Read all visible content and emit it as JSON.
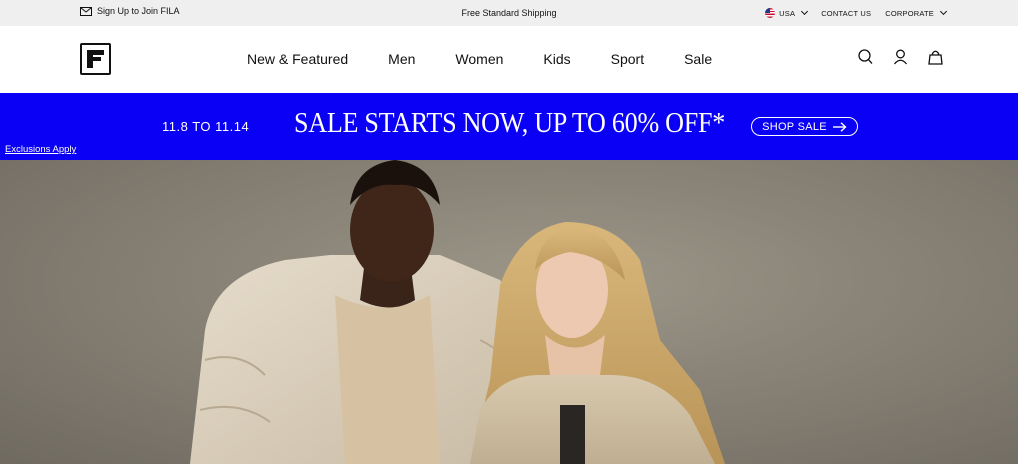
{
  "utility_bar": {
    "signup_text": "Sign Up to Join FILA",
    "shipping_text": "Free Standard Shipping",
    "country_label": "USA",
    "contact_label": "CONTACT US",
    "corporate_label": "CORPORATE"
  },
  "header": {
    "logo_icon": "fila-f-logo-icon",
    "nav": [
      {
        "label": "New & Featured"
      },
      {
        "label": "Men"
      },
      {
        "label": "Women"
      },
      {
        "label": "Kids"
      },
      {
        "label": "Sport"
      },
      {
        "label": "Sale"
      }
    ],
    "icons": [
      "search-icon",
      "account-icon",
      "bag-icon"
    ]
  },
  "promo": {
    "dates": "11.8 TO 11.14",
    "headline": "SALE STARTS NOW, UP TO 60% OFF*",
    "cta_label": "SHOP SALE",
    "exclusions_label": "Exclusions Apply",
    "background_color": "#0a00f5"
  }
}
